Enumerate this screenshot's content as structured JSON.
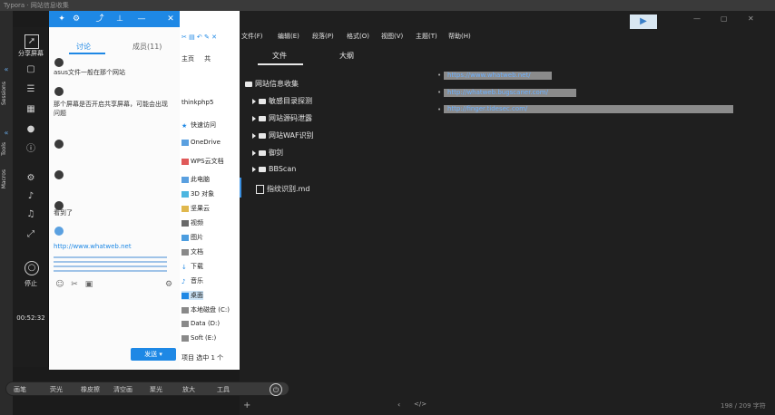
{
  "window": {
    "title": "Typora · 网站信息收集"
  },
  "left_rail": {
    "items": [
      {
        "label": "Sessions"
      },
      {
        "label": "Tools"
      },
      {
        "label": "Macros"
      }
    ]
  },
  "sidebar": {
    "share_label": "分享屏幕",
    "time": "00:52:32",
    "bottom_label": "停止"
  },
  "chat": {
    "tabs": [
      "讨论",
      "成员(11)"
    ],
    "messages": [
      {
        "text": "asus文件一般在那个网站"
      },
      {
        "text": "那个屏幕是否开启共享屏幕，可能会出现问题"
      },
      {
        "text": "看到了"
      },
      {
        "text": "http://www.whatweb.net"
      }
    ],
    "send_label": "发送"
  },
  "explorer": {
    "title": "thinkphp5",
    "items": [
      "快速访问",
      "OneDrive",
      "WPS云文档",
      "此电脑",
      "3D 对象",
      "坚果云",
      "视频",
      "图片",
      "文档",
      "下载",
      "音乐",
      "桌面",
      "本地磁盘 (C:)",
      "Data (D:)",
      "Soft (E:)"
    ],
    "status": "项目    选中 1 个"
  },
  "editor": {
    "menu": [
      "文件(F)",
      "编辑(E)",
      "段落(P)",
      "格式(O)",
      "视图(V)",
      "主题(T)",
      "帮助(H)"
    ],
    "side_tabs": [
      "文件",
      "大纲"
    ],
    "tree": [
      {
        "label": "网站信息收集",
        "type": "folder-open"
      },
      {
        "label": "敏感目录探测",
        "type": "folder"
      },
      {
        "label": "网站源码泄露",
        "type": "folder"
      },
      {
        "label": "网站WAF识别",
        "type": "folder"
      },
      {
        "label": "御剑",
        "type": "folder"
      },
      {
        "label": "BBScan",
        "type": "folder"
      },
      {
        "label": "指纹识别.md",
        "type": "file"
      }
    ],
    "links": [
      "https://www.whatweb.net/",
      "http://whatweb.bugscaner.com/",
      "http://finger.tidesec.com/"
    ],
    "status_count": "198 / 209 字符"
  },
  "taskbar": {
    "items": [
      "画笔",
      "荧光",
      "橡皮擦",
      "清空画",
      "聚光",
      "放大",
      "工具"
    ]
  }
}
